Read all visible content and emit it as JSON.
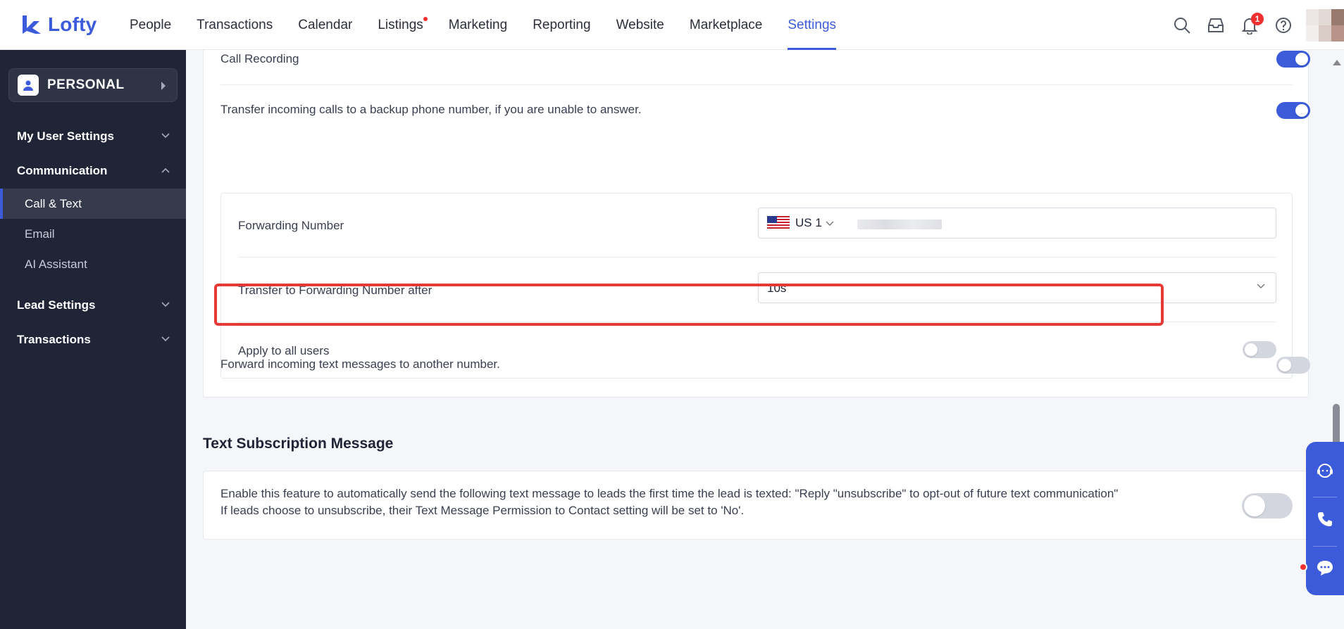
{
  "app": {
    "logo_text": "Lofty",
    "brand_color": "#3b5bdb"
  },
  "nav": {
    "items": [
      {
        "label": "People"
      },
      {
        "label": "Transactions"
      },
      {
        "label": "Calendar"
      },
      {
        "label": "Listings",
        "has_dot": true
      },
      {
        "label": "Marketing"
      },
      {
        "label": "Reporting"
      },
      {
        "label": "Website"
      },
      {
        "label": "Marketplace"
      },
      {
        "label": "Settings",
        "active": true
      }
    ],
    "notification_count": "1",
    "icons": [
      "search-icon",
      "inbox-icon",
      "bell-icon",
      "help-icon",
      "avatar"
    ]
  },
  "sidebar": {
    "persona_label": "PERSONAL",
    "groups": [
      {
        "label": "My User Settings",
        "expanded": false
      },
      {
        "label": "Communication",
        "expanded": true,
        "items": [
          {
            "label": "Call & Text",
            "active": true
          },
          {
            "label": "Email"
          },
          {
            "label": "AI Assistant"
          }
        ]
      },
      {
        "label": "Lead Settings",
        "expanded": false
      },
      {
        "label": "Transactions",
        "expanded": false
      }
    ]
  },
  "call_settings": {
    "call_recording": {
      "label": "Call Recording",
      "enabled": true
    },
    "transfer_calls": {
      "label": "Transfer incoming calls to a backup phone number, if you are unable to answer.",
      "enabled": true
    },
    "forwarding_number": {
      "label": "Forwarding Number",
      "country": "US",
      "code": "1"
    },
    "transfer_after": {
      "label": "Transfer to Forwarding Number after",
      "value": "10s"
    },
    "apply_all": {
      "label": "Apply to all users",
      "enabled": false
    },
    "forward_texts": {
      "label": "Forward incoming text messages to another number.",
      "enabled": false,
      "highlight_color": "#e53935"
    }
  },
  "text_subscription": {
    "title": "Text Subscription Message",
    "line1": "Enable this feature to automatically send the following text message to leads the first time the lead is texted: \"Reply \"unsubscribe\" to opt-out of future text communication\"",
    "line2": "If leads choose to unsubscribe, their Text Message Permission to Contact setting will be set to 'No'.",
    "enabled": false
  },
  "floating_widget": {
    "icons": [
      "support-chat-icon",
      "phone-icon",
      "message-icon"
    ]
  }
}
